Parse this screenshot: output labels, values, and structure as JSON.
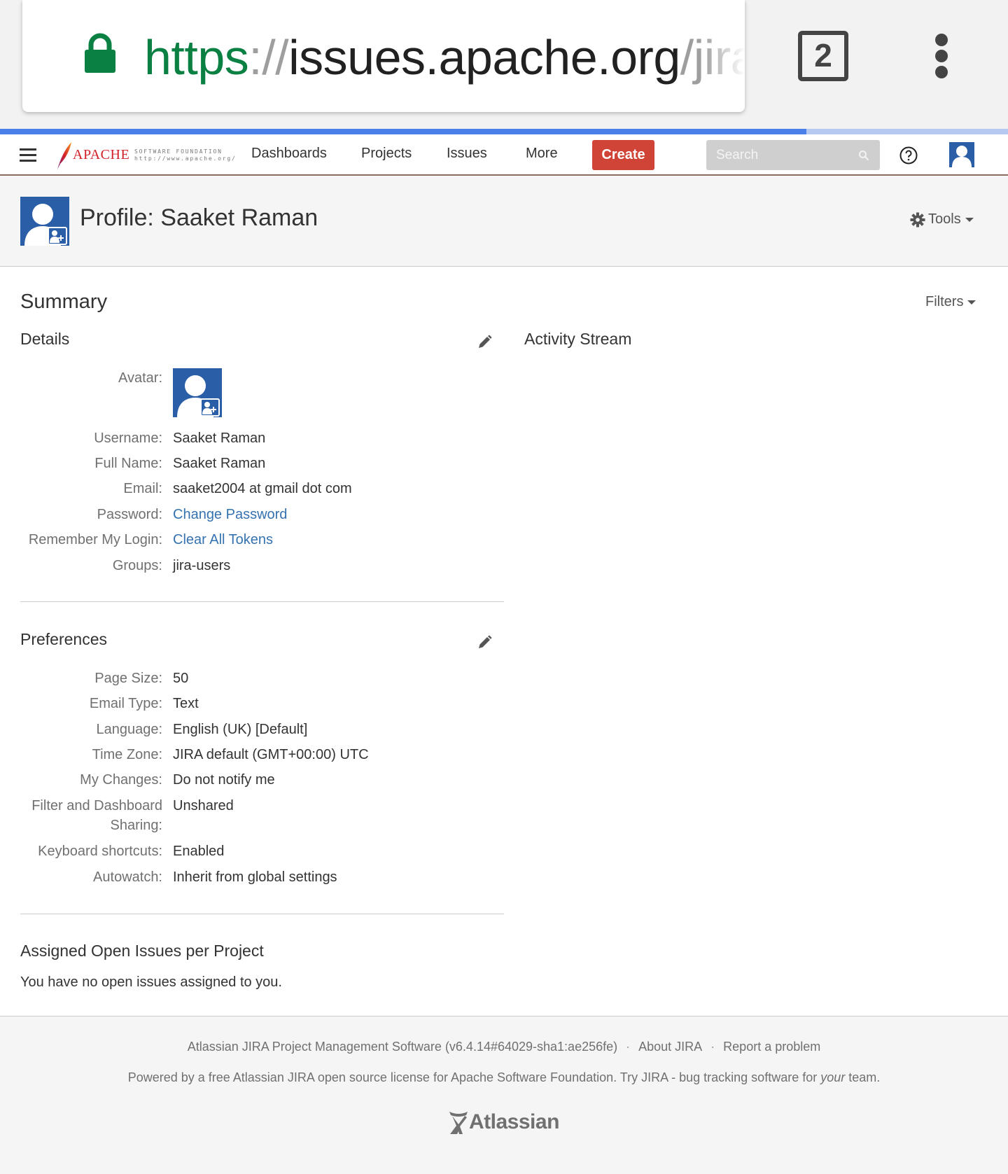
{
  "browser": {
    "url_scheme": "https",
    "url_separator": "://",
    "url_host": "issues.apache.org",
    "url_path": "/jira/",
    "tab_count": "2",
    "lock_icon": "lock-icon",
    "menu_icon": "kebab-menu-icon",
    "load_progress": 0.8
  },
  "nav": {
    "logo_word": "APACHE",
    "logo_small_line1": "SOFTWARE FOUNDATION",
    "logo_small_line2": "http://www.apache.org/",
    "items": [
      "Dashboards",
      "Projects",
      "Issues",
      "More"
    ],
    "create_label": "Create",
    "search_placeholder": "Search",
    "accent_color": "#d04437"
  },
  "header": {
    "title": "Profile: Saaket Raman",
    "tools_label": "Tools"
  },
  "summary": {
    "title": "Summary",
    "filters_label": "Filters",
    "activity_title": "Activity Stream"
  },
  "details": {
    "title": "Details",
    "avatar_label": "Avatar:",
    "fields": [
      {
        "label": "Username:",
        "value": "Saaket Raman"
      },
      {
        "label": "Full Name:",
        "value": "Saaket Raman"
      },
      {
        "label": "Email:",
        "value": "saaket2004 at gmail dot com"
      },
      {
        "label": "Password:",
        "value": "Change Password"
      },
      {
        "label": "Remember My Login:",
        "value": "Clear All Tokens"
      },
      {
        "label": "Groups:",
        "value": "jira-users"
      }
    ]
  },
  "preferences": {
    "title": "Preferences",
    "fields": [
      {
        "label": "Page Size:",
        "value": "50"
      },
      {
        "label": "Email Type:",
        "value": "Text"
      },
      {
        "label": "Language:",
        "value": "English (UK) [Default]"
      },
      {
        "label": "Time Zone:",
        "value": "JIRA default (GMT+00:00) UTC"
      },
      {
        "label": "My Changes:",
        "value": "Do not notify me"
      },
      {
        "label": "Filter and Dashboard",
        "label2": "Sharing:",
        "value": "Unshared"
      },
      {
        "label": "Keyboard shortcuts:",
        "value": "Enabled"
      },
      {
        "label": "Autowatch:",
        "value": "Inherit from global settings"
      }
    ]
  },
  "issues": {
    "title": "Assigned Open Issues per Project",
    "text": "You have no open issues assigned to you."
  },
  "footer": {
    "software": "Atlassian JIRA Project Management Software (v6.4.14#64029-sha1:ae256fe)",
    "dot": "·",
    "about": "About JIRA",
    "report": "Report a problem",
    "powered_pre": "Powered by a free Atlassian JIRA open source license for Apache Software Foundation. Try JIRA - bug tracking software for ",
    "powered_em": "your",
    "powered_post": " team.",
    "logo_word": "Atlassian"
  }
}
